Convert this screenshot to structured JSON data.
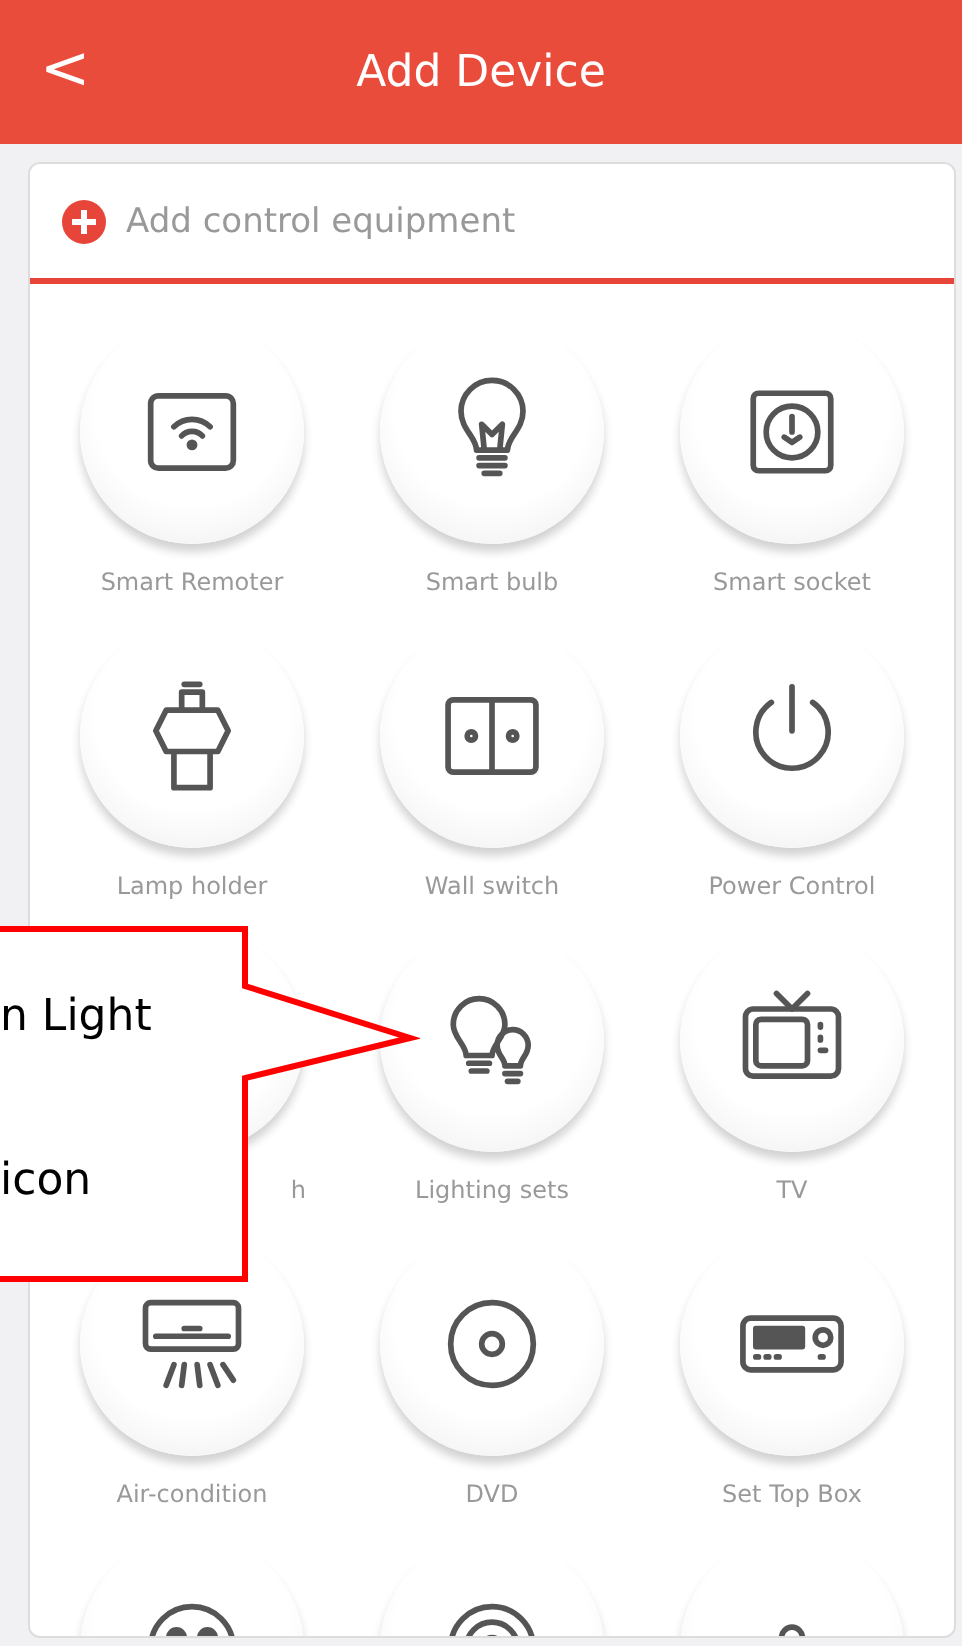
{
  "header": {
    "back": "<",
    "title": "Add Device"
  },
  "add_row": {
    "label": "Add control equipment"
  },
  "devices": [
    {
      "kind": "full",
      "label": "Smart Remoter"
    },
    {
      "kind": "full",
      "label": "Smart bulb"
    },
    {
      "kind": "full",
      "label": "Smart socket"
    },
    {
      "kind": "full",
      "label": "Lamp holder"
    },
    {
      "kind": "full",
      "label": "Wall switch"
    },
    {
      "kind": "full",
      "label": "Power Control"
    },
    {
      "kind": "covered",
      "label": "h"
    },
    {
      "kind": "full",
      "label": "Lighting sets"
    },
    {
      "kind": "full",
      "label": "TV"
    },
    {
      "kind": "full",
      "label": "Air-condition"
    },
    {
      "kind": "full",
      "label": "DVD"
    },
    {
      "kind": "full",
      "label": "Set Top Box"
    },
    {
      "kind": "cut"
    },
    {
      "kind": "cut"
    },
    {
      "kind": "cut"
    }
  ],
  "callout": {
    "lines": [
      "n Light",
      "icon"
    ]
  }
}
